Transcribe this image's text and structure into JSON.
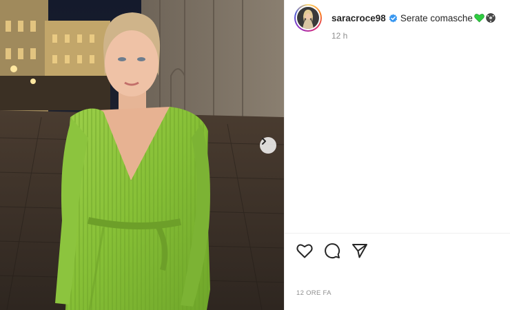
{
  "post": {
    "username": "saracroce98",
    "caption": "Serate comasche",
    "time_ago": "12 h",
    "date_label": "12 ORE FA"
  },
  "icons": {
    "verified": "verified-badge-icon",
    "caption_emojis": [
      "green-heart-icon",
      "soccer-ball-icon"
    ],
    "next": "chevron-right-icon",
    "like": "heart-icon",
    "comment": "comment-icon",
    "share": "paper-plane-icon"
  },
  "colors": {
    "verified_blue": "#3897f0",
    "text": "#262626",
    "muted": "#8e8e8e",
    "green_heart": "#2ecc40"
  }
}
